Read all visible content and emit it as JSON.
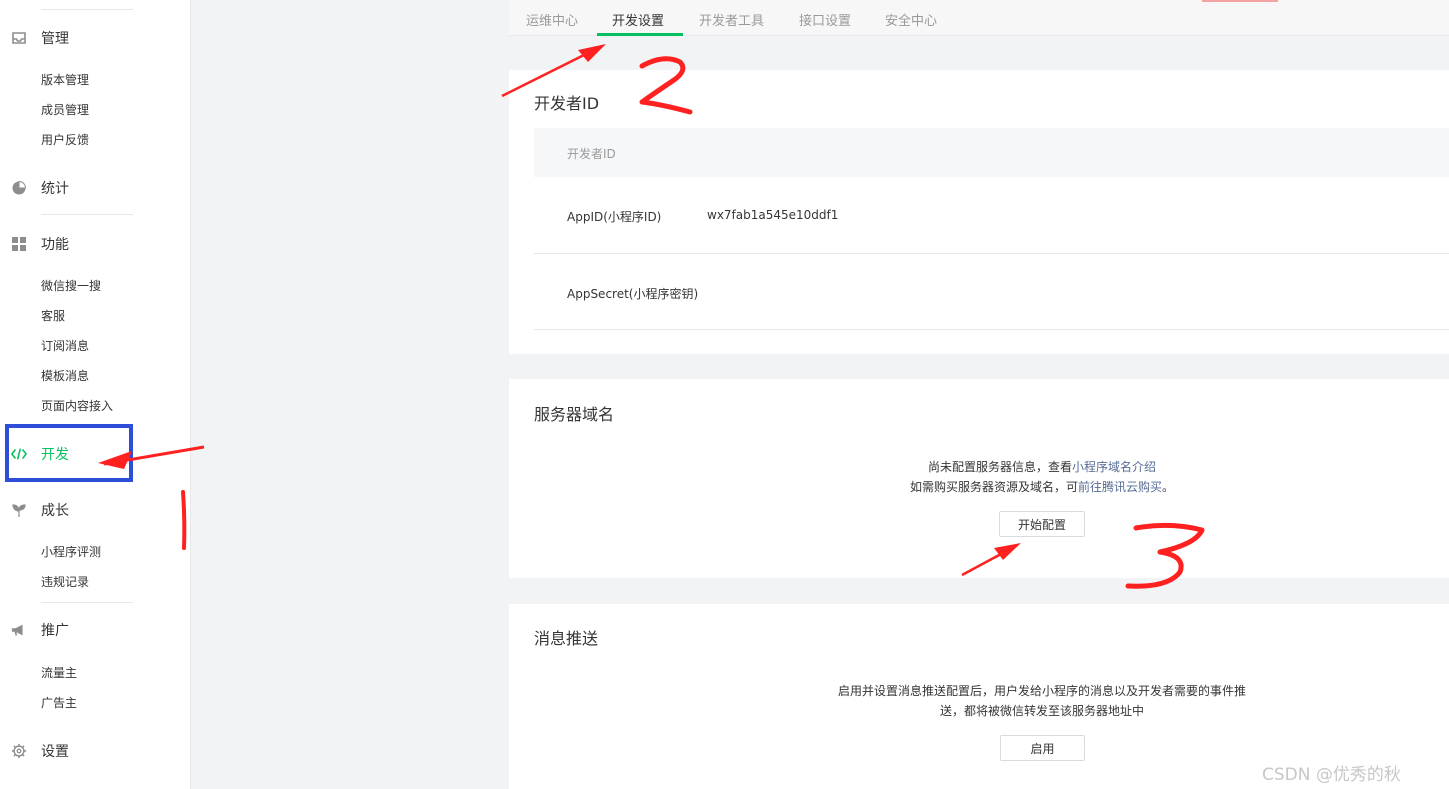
{
  "sidebar": {
    "sections": [
      {
        "id": "manage",
        "icon": "inbox-icon",
        "label": "管理",
        "items": [
          "版本管理",
          "成员管理",
          "用户反馈"
        ]
      },
      {
        "id": "stats",
        "icon": "pie-chart-icon",
        "label": "统计",
        "items": []
      },
      {
        "id": "features",
        "icon": "grid-icon",
        "label": "功能",
        "items": [
          "微信搜一搜",
          "客服",
          "订阅消息",
          "模板消息",
          "页面内容接入"
        ]
      },
      {
        "id": "develop",
        "icon": "code-icon",
        "label": "开发",
        "items": []
      },
      {
        "id": "growth",
        "icon": "sprout-icon",
        "label": "成长",
        "items": [
          "小程序评测",
          "违规记录"
        ]
      },
      {
        "id": "promote",
        "icon": "megaphone-icon",
        "label": "推广",
        "items": [
          "流量主",
          "广告主"
        ]
      },
      {
        "id": "settings",
        "icon": "gear-icon",
        "label": "设置",
        "items": []
      }
    ],
    "active_section": "开发"
  },
  "tabs": [
    {
      "label": "运维中心",
      "active": false
    },
    {
      "label": "开发设置",
      "active": true
    },
    {
      "label": "开发者工具",
      "active": false
    },
    {
      "label": "接口设置",
      "active": false
    },
    {
      "label": "安全中心",
      "active": false
    }
  ],
  "developer_id": {
    "title": "开发者ID",
    "table_header": "开发者ID",
    "rows": [
      {
        "label": "AppID(小程序ID)",
        "value": "wx7fab1a545e10ddf1"
      },
      {
        "label": "AppSecret(小程序密钥)",
        "value": ""
      }
    ]
  },
  "server_domain": {
    "title": "服务器域名",
    "line1_prefix": "尚未配置服务器信息，查看",
    "line1_link": "小程序域名介绍",
    "line2_prefix": "如需购买服务器资源及域名，可",
    "line2_link": "前往腾讯云购买",
    "line2_suffix": "。",
    "button_label": "开始配置"
  },
  "message_push": {
    "title": "消息推送",
    "line1": "启用并设置消息推送配置后，用户发给小程序的消息以及开发者需要的事件推",
    "line2": "送，都将被微信转发至该服务器地址中",
    "button_label": "启用"
  },
  "annotations": {
    "mark1": "1",
    "mark2": "2",
    "mark3": "3"
  },
  "watermark": "CSDN @优秀的秋",
  "colors": {
    "accent": "#07c160",
    "link": "#576b95",
    "annotation_red": "#ff2020",
    "highlight_blue": "#2d4ed8"
  }
}
